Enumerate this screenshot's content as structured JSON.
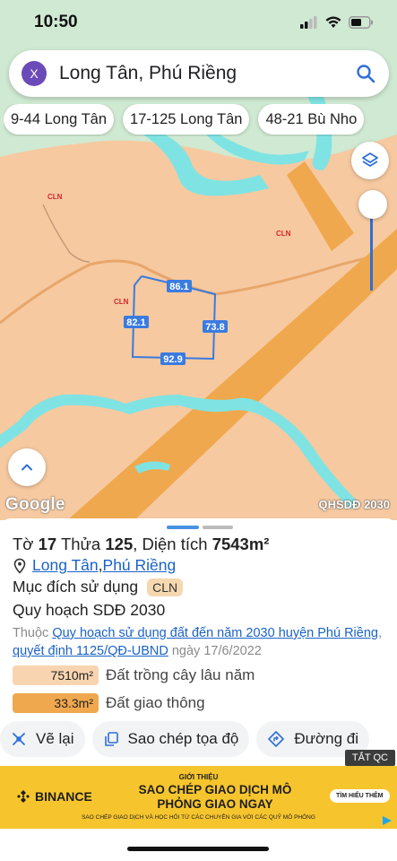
{
  "status": {
    "time": "10:50"
  },
  "search": {
    "close_label": "X",
    "query": "Long Tân, Phú Riềng"
  },
  "chips": [
    "9-44 Long Tân",
    "17-125 Long Tân",
    "48-21 Bù Nho"
  ],
  "map": {
    "zone_labels": [
      "CLN",
      "CLN",
      "CLN"
    ],
    "dimensions": [
      "86.1",
      "82.1",
      "73.8",
      "92.9"
    ],
    "google_label": "Google",
    "source_label": "QHSDĐ 2030"
  },
  "parcel": {
    "title_prefix": "Tờ ",
    "sheet_no": "17",
    "title_mid": " Thửa ",
    "parcel_no": "125",
    "title_suffix": ", Diện tích ",
    "area": "7543m²",
    "commune": "Long Tân",
    "separator": ", ",
    "district": "Phú Riềng",
    "purpose_label": "Mục đích sử dụng",
    "purpose_code": "CLN",
    "plan_label": "Quy hoạch SDĐ 2030",
    "belongs_prefix": "Thuộc ",
    "plan_link": "Quy hoạch sử dụng đất đến năm 2030 huyện Phú Riềng",
    "decision_link": "quyết định 1125/QĐ-UBND",
    "date_text": " ngày 17/6/2022",
    "land_uses": [
      {
        "area": "7510m²",
        "label": "Đất trồng cây lâu năm",
        "color": "#f8d5b0"
      },
      {
        "area": "33.3m²",
        "label": "Đất giao thông",
        "color": "#f0a84e"
      }
    ]
  },
  "actions": [
    "Vẽ lại",
    "Sao chép tọa độ",
    "Đường đi"
  ],
  "ad": {
    "tag": "TẮT QC",
    "brand": "BINANCE",
    "intro": "GIỚI THIỆU",
    "headline": "SAO CHÉP GIAO DỊCH MÔ PHỎNG GIAO NGAY",
    "sub": "SAO CHÉP GIAO DỊCH VÀ HỌC HỎI TỪ CÁC CHUYÊN GIA VỚI CÁC QUỸ MÔ PHỎNG",
    "cta": "TÌM HIỂU THÊM"
  },
  "colors": {
    "map_bg": "#f6c9a0",
    "river": "#7fe3e3",
    "road": "#f0a84e",
    "link": "#1a62c8",
    "ad_bg": "#f6c52e"
  }
}
